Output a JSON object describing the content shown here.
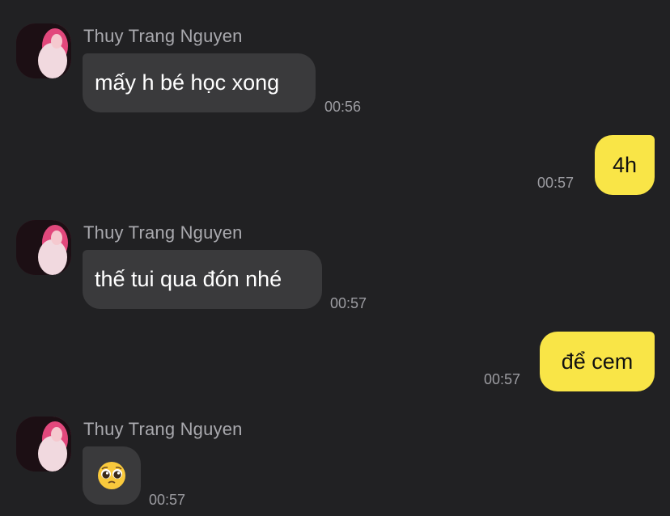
{
  "messages": [
    {
      "sender": "Thuy Trang Nguyen",
      "text": "mấy h bé học xong",
      "time": "00:56",
      "mine": false
    },
    {
      "text": "4h",
      "time": "00:57",
      "mine": true
    },
    {
      "sender": "Thuy Trang Nguyen",
      "text": "thế tui qua đón nhé",
      "time": "00:57",
      "mine": false
    },
    {
      "text": "để cem",
      "time": "00:57",
      "mine": true
    },
    {
      "sender": "Thuy Trang Nguyen",
      "emoji": "pleading-face",
      "time": "00:57",
      "mine": false
    }
  ],
  "colors": {
    "background": "#212123",
    "incoming_bubble": "#3a3a3c",
    "outgoing_bubble": "#f9e547",
    "sender_name": "#a9a9ae",
    "timestamp": "#9c9ca1"
  }
}
